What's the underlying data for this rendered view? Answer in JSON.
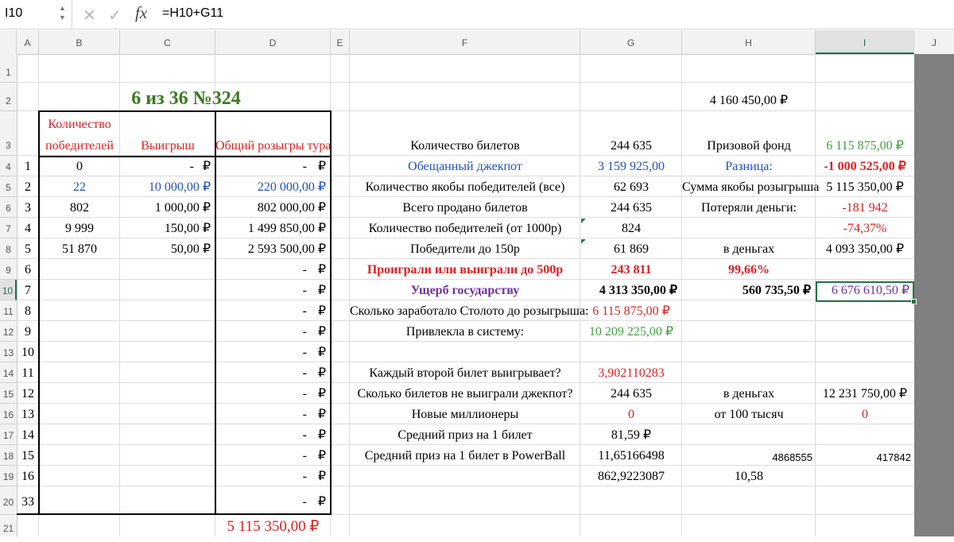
{
  "formula_bar": {
    "name_box": "I10",
    "cancel_icon": "✕",
    "enter_icon": "✓",
    "fx_label": "fx",
    "formula": "=H10+G11"
  },
  "columns": [
    "A",
    "B",
    "C",
    "D",
    "E",
    "F",
    "G",
    "H",
    "I",
    "J"
  ],
  "rows": [
    "1",
    "2",
    "3",
    "4",
    "5",
    "6",
    "7",
    "8",
    "9",
    "10",
    "11",
    "12",
    "13",
    "14",
    "15",
    "16",
    "17",
    "18",
    "19",
    "20",
    "21"
  ],
  "selected_cell": "I10",
  "colors": {
    "accent": "#217346",
    "red": "#e02020",
    "blue": "#2050c0",
    "green": "#40a040",
    "title_green": "#3c7a22",
    "purple": "#7030a0"
  },
  "table": {
    "title": "6 из 36 №324",
    "header_winners_1": "Количество",
    "header_winners_2": "победителей",
    "header_prize": "Выигрыш",
    "header_total": "Общий розыгры тура",
    "rows": [
      {
        "n": "1",
        "winners": "0",
        "prize": "-",
        "total": "-"
      },
      {
        "n": "2",
        "winners": "22",
        "prize": "10 000,00 ₽",
        "total": "220 000,00 ₽"
      },
      {
        "n": "3",
        "winners": "802",
        "prize": "1 000,00 ₽",
        "total": "802 000,00 ₽"
      },
      {
        "n": "4",
        "winners": "9 999",
        "prize": "150,00 ₽",
        "total": "1 499 850,00 ₽"
      },
      {
        "n": "5",
        "winners": "51 870",
        "prize": "50,00 ₽",
        "total": "2 593 500,00 ₽"
      },
      {
        "n": "6",
        "winners": "",
        "prize": "",
        "total": "-"
      },
      {
        "n": "7",
        "winners": "",
        "prize": "",
        "total": "-"
      },
      {
        "n": "8",
        "winners": "",
        "prize": "",
        "total": "-"
      },
      {
        "n": "9",
        "winners": "",
        "prize": "",
        "total": "-"
      },
      {
        "n": "10",
        "winners": "",
        "prize": "",
        "total": "-"
      },
      {
        "n": "11",
        "winners": "",
        "prize": "",
        "total": "-"
      },
      {
        "n": "12",
        "winners": "",
        "prize": "",
        "total": "-"
      },
      {
        "n": "13",
        "winners": "",
        "prize": "",
        "total": "-"
      },
      {
        "n": "14",
        "winners": "",
        "prize": "",
        "total": "-"
      },
      {
        "n": "15",
        "winners": "",
        "prize": "",
        "total": "-"
      },
      {
        "n": "16",
        "winners": "",
        "prize": "",
        "total": "-"
      },
      {
        "n": "33",
        "winners": "",
        "prize": "",
        "total": "-"
      }
    ],
    "rub": "₽",
    "grand_total": "5 115 350,00 ₽"
  },
  "stats": {
    "h2": "4 160 450,00 ₽",
    "f3": "Количество билетов",
    "g3": "244 635",
    "h3": "Призовой фонд",
    "i3": "6 115 875,00 ₽",
    "f4": "Обещанный джекпот",
    "g4": "3 159 925,00",
    "h4": "Разница:",
    "i4": "-1 000 525,00 ₽",
    "f5": "Количество якобы победителей (все)",
    "g5": "62 693",
    "h5": "Сумма якобы розыгрыша",
    "i5": "5 115 350,00 ₽",
    "f6": "Всего продано билетов",
    "g6": "244 635",
    "h6": "Потеряли деньги:",
    "i6": "-181 942",
    "f7": "Количество победителей (от 1000р)",
    "g7": "824",
    "i7": "-74,37%",
    "f8": "Победители до 150р",
    "g8": "61 869",
    "h8": "в деньгах",
    "i8": "4 093 350,00 ₽",
    "f9": "Проиграли или выиграли до 500р",
    "g9": "243 811",
    "h9": "99,66%",
    "f10": "Ущерб государству",
    "g10": "4 313 350,00 ₽",
    "h10": "560 735,50 ₽",
    "i10": "6 676 610,50 ₽",
    "f11": "Сколько заработало Столото до розыгрыша:",
    "g11": "6 115 875,00 ₽",
    "f12": "Привлекла в систему:",
    "g12": "10 209 225,00 ₽",
    "f14": "Каждый второй билет выигрывает?",
    "g14": "3,902110283",
    "f15": "Сколько билетов не выиграли джекпот?",
    "g15": "244 635",
    "h15": "в деньгах",
    "i15": "12 231 750,00 ₽",
    "f16": "Новые миллионеры",
    "g16": "0",
    "h16": "от 100 тысяч",
    "i16": "0",
    "f17": "Средний приз на 1 билет",
    "g17": "81,59 ₽",
    "f18": "Средний приз на 1 билет в PowerBall",
    "g18": "11,65166498",
    "h18": "4868555",
    "i18": "417842",
    "g19": "862,9223087",
    "h19": "10,58"
  }
}
